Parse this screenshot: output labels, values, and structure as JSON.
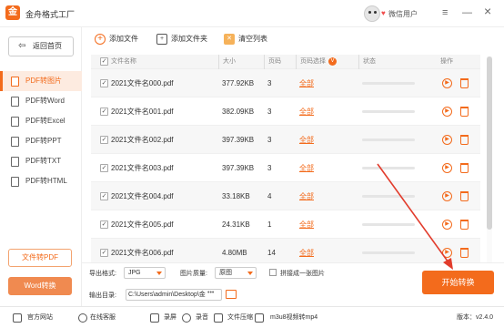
{
  "app": {
    "title": "金舟格式工厂",
    "user_label": "微信用户"
  },
  "window_controls": {
    "menu": "≡",
    "minimize": "—",
    "close": "×"
  },
  "sidebar": {
    "home": "返回首页",
    "items": [
      {
        "label": "PDF转图片",
        "active": true
      },
      {
        "label": "PDF转Word",
        "active": false
      },
      {
        "label": "PDF转Excel",
        "active": false
      },
      {
        "label": "PDF转PPT",
        "active": false
      },
      {
        "label": "PDF转TXT",
        "active": false
      },
      {
        "label": "PDF转HTML",
        "active": false
      }
    ],
    "file_to_pdf": "文件转PDF",
    "word_convert": "Word转换"
  },
  "toolbar": {
    "add_file": "添加文件",
    "add_folder": "添加文件夹",
    "clear_list": "清空列表"
  },
  "table": {
    "headers": {
      "name": "文件名称",
      "size": "大小",
      "pages": "页码",
      "page_select": "页码选择",
      "page_select_badge": "V",
      "status": "状态",
      "actions": "操作"
    },
    "rows": [
      {
        "name": "2021文件名000.pdf",
        "size": "377.92KB",
        "pages": "3",
        "selection": "全部",
        "progress": 0.0
      },
      {
        "name": "2021文件名001.pdf",
        "size": "382.09KB",
        "pages": "3",
        "selection": "全部",
        "progress": 0.0
      },
      {
        "name": "2021文件名002.pdf",
        "size": "397.39KB",
        "pages": "3",
        "selection": "全部",
        "progress": 0.0
      },
      {
        "name": "2021文件名003.pdf",
        "size": "397.39KB",
        "pages": "3",
        "selection": "全部",
        "progress": 0.0
      },
      {
        "name": "2021文件名004.pdf",
        "size": "33.18KB",
        "pages": "4",
        "selection": "全部",
        "progress": 0.0
      },
      {
        "name": "2021文件名005.pdf",
        "size": "24.31KB",
        "pages": "1",
        "selection": "全部",
        "progress": 0.0
      },
      {
        "name": "2021文件名006.pdf",
        "size": "4.80MB",
        "pages": "14",
        "selection": "全部",
        "progress": 0.0
      }
    ]
  },
  "bottom": {
    "export_format_label": "导出格式:",
    "export_format_value": "JPG",
    "image_quality_label": "图片质量:",
    "image_quality_value": "原图",
    "merge_label": "拼接成一张图片",
    "output_dir_label": "输出目录:",
    "output_dir_value": "C:\\Users\\admin\\Desktop\\金",
    "dots": "•••",
    "start_button": "开始转换"
  },
  "statusbar": {
    "website": "官方网站",
    "support": "在线客服",
    "record_screen": "录屏",
    "record_audio": "录音",
    "file_tool": "文件压缩",
    "convert_tool": "m3u8视频转mp4",
    "version": "版本：v2.4.0"
  },
  "colors": {
    "accent": "#f36b1c",
    "arrow": "#e23c2c"
  }
}
